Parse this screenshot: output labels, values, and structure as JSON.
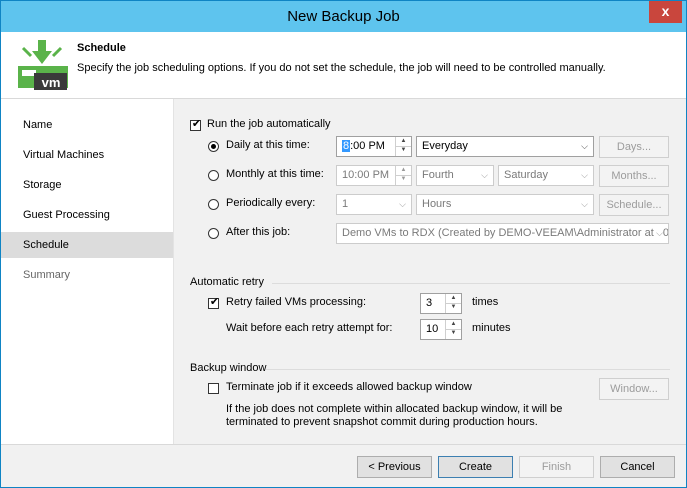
{
  "window": {
    "title": "New Backup Job",
    "close_label": "x"
  },
  "header": {
    "title": "Schedule",
    "description": "Specify the job scheduling options. If you do not set the schedule, the job will need to be controlled manually.",
    "logo_text": "vm"
  },
  "sidebar": {
    "items": [
      {
        "label": "Name"
      },
      {
        "label": "Virtual Machines"
      },
      {
        "label": "Storage"
      },
      {
        "label": "Guest Processing"
      },
      {
        "label": "Schedule"
      },
      {
        "label": "Summary"
      }
    ]
  },
  "schedule": {
    "run_automatically": {
      "label": "Run the job automatically",
      "checked": true
    },
    "daily": {
      "label": "Daily at this time:",
      "time": "8:00 PM",
      "time_rest": ":00 PM",
      "time_first": "8",
      "frequency": "Everyday",
      "button": "Days..."
    },
    "monthly": {
      "label": "Monthly at this time:",
      "time": "10:00 PM",
      "week": "Fourth",
      "day": "Saturday",
      "button": "Months..."
    },
    "periodically": {
      "label": "Periodically every:",
      "value": "1",
      "unit": "Hours",
      "button": "Schedule..."
    },
    "after_job": {
      "label": "After this job:",
      "value": "Demo VMs to RDX (Created by DEMO-VEEAM\\Administrator at 10"
    }
  },
  "retry": {
    "section_title": "Automatic retry",
    "retry_label": "Retry failed VMs processing:",
    "retry_checked": true,
    "retry_count": "3",
    "retry_unit": "times",
    "wait_label": "Wait before each retry attempt for:",
    "wait_value": "10",
    "wait_unit": "minutes"
  },
  "backup_window": {
    "section_title": "Backup window",
    "terminate_label": "Terminate job if it exceeds allowed backup window",
    "terminate_checked": false,
    "button": "Window...",
    "note_line1": "If the job does not complete within allocated backup window, it will be",
    "note_line2": "terminated to prevent snapshot commit during production hours."
  },
  "footer": {
    "previous": "< Previous",
    "create": "Create",
    "finish": "Finish",
    "cancel": "Cancel"
  },
  "colors": {
    "titlebar": "#5ec4ee",
    "close": "#c9463d",
    "logo_green": "#5ab34a",
    "logo_dark": "#3a3a3a"
  }
}
